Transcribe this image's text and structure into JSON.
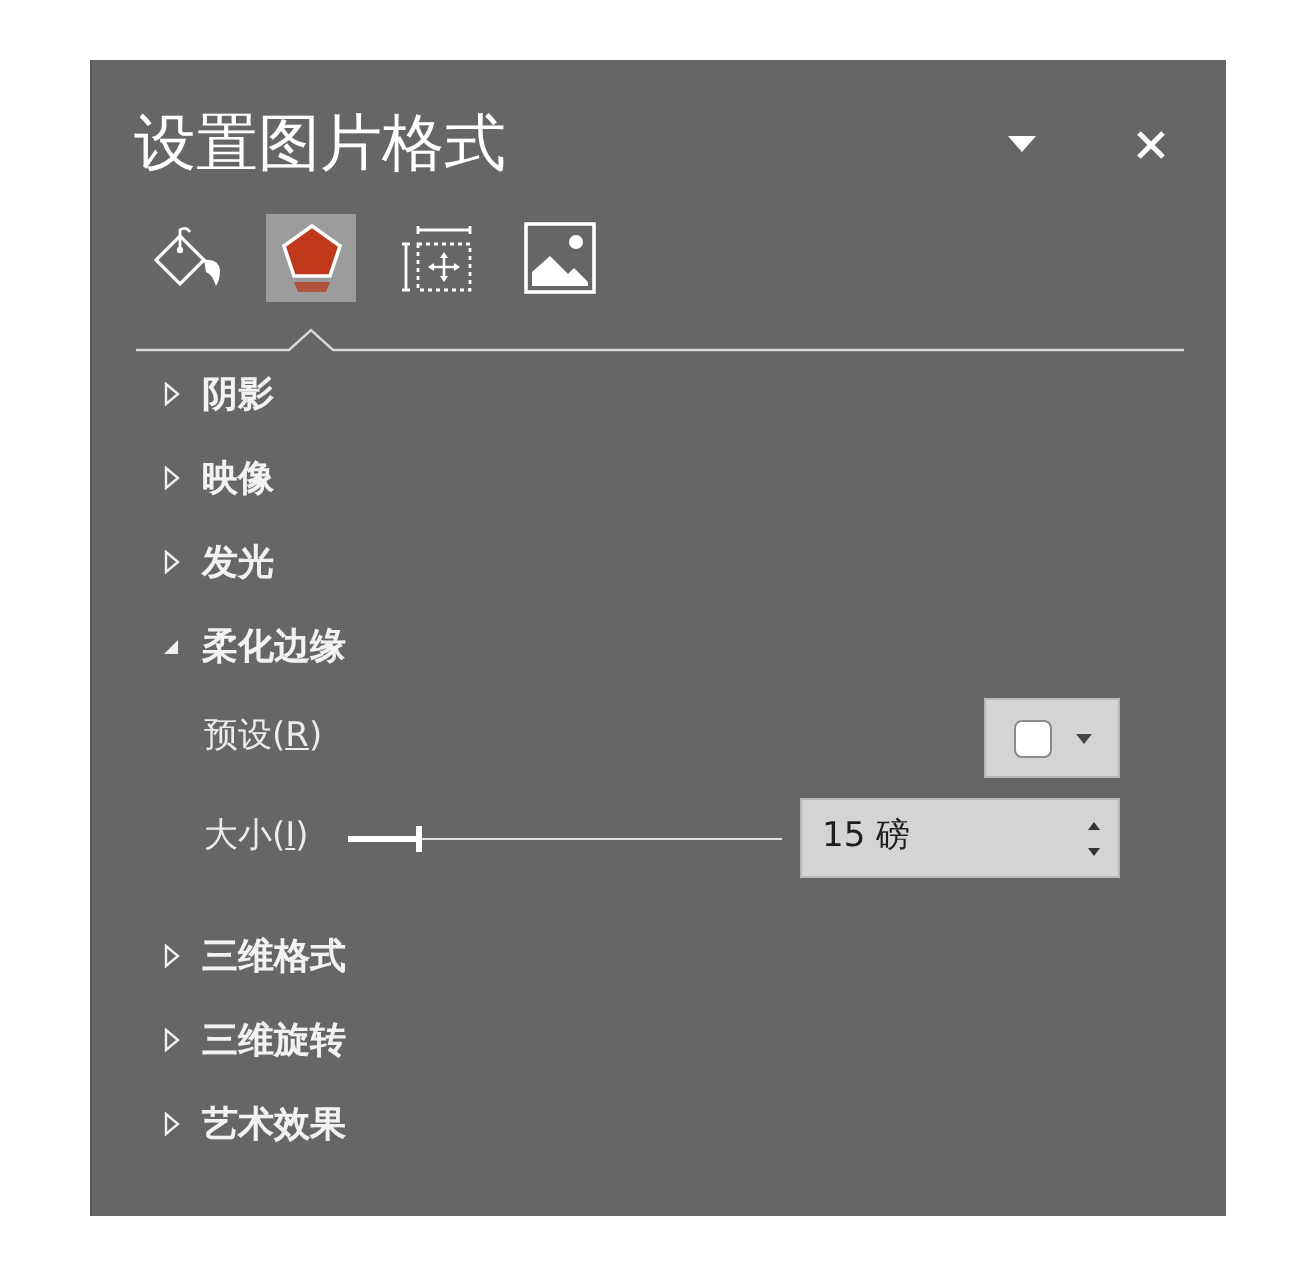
{
  "panel": {
    "title": "设置图片格式"
  },
  "tabs": [
    {
      "kind": "fill",
      "selected": false
    },
    {
      "kind": "effects",
      "selected": true
    },
    {
      "kind": "size",
      "selected": false
    },
    {
      "kind": "picture",
      "selected": false
    }
  ],
  "sections": [
    {
      "label": "阴影",
      "expanded": false
    },
    {
      "label": "映像",
      "expanded": false
    },
    {
      "label": "发光",
      "expanded": false
    },
    {
      "label": "柔化边缘",
      "expanded": true,
      "fields": [
        {
          "kind": "preset",
          "label_before": "预设(",
          "access_key": "R",
          "label_after": ")"
        },
        {
          "kind": "slider",
          "label_before": "大小(",
          "access_key": "I",
          "label_after": ")",
          "level": 0.16,
          "value": "15 磅"
        }
      ]
    },
    {
      "label": "三维格式",
      "expanded": false
    },
    {
      "label": "三维旋转",
      "expanded": false
    },
    {
      "label": "艺术效果",
      "expanded": false
    }
  ]
}
